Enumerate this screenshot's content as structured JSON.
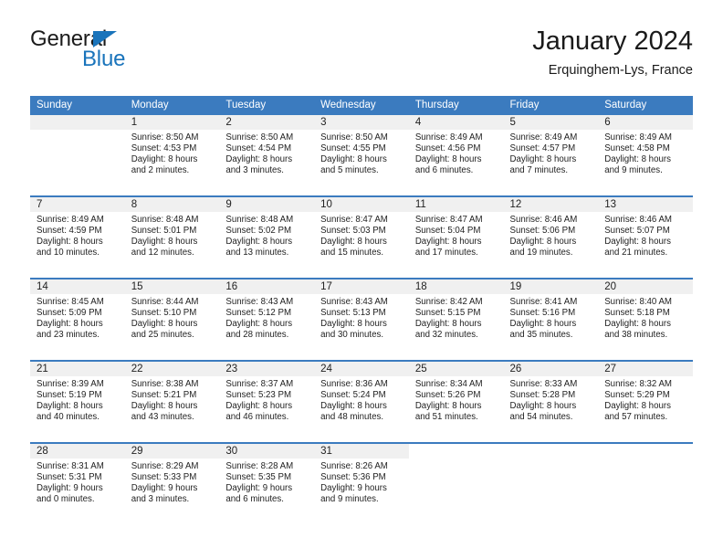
{
  "brand": {
    "name_part1": "General",
    "name_part2": "Blue",
    "colors": {
      "dark": "#1b1b1b",
      "blue": "#1a74bb"
    }
  },
  "header": {
    "title": "January 2024",
    "subtitle": "Erquinghem-Lys, France"
  },
  "theme": {
    "header_blue": "#3b7bbf",
    "daynum_band": "#f0f0f0",
    "cell_bg": "#ffffff",
    "text": "#1f1f1f"
  },
  "weekday_headers": [
    "Sunday",
    "Monday",
    "Tuesday",
    "Wednesday",
    "Thursday",
    "Friday",
    "Saturday"
  ],
  "weeks": [
    [
      {
        "day": "",
        "lines": []
      },
      {
        "day": "1",
        "lines": [
          "Sunrise: 8:50 AM",
          "Sunset: 4:53 PM",
          "Daylight: 8 hours",
          "and 2 minutes."
        ]
      },
      {
        "day": "2",
        "lines": [
          "Sunrise: 8:50 AM",
          "Sunset: 4:54 PM",
          "Daylight: 8 hours",
          "and 3 minutes."
        ]
      },
      {
        "day": "3",
        "lines": [
          "Sunrise: 8:50 AM",
          "Sunset: 4:55 PM",
          "Daylight: 8 hours",
          "and 5 minutes."
        ]
      },
      {
        "day": "4",
        "lines": [
          "Sunrise: 8:49 AM",
          "Sunset: 4:56 PM",
          "Daylight: 8 hours",
          "and 6 minutes."
        ]
      },
      {
        "day": "5",
        "lines": [
          "Sunrise: 8:49 AM",
          "Sunset: 4:57 PM",
          "Daylight: 8 hours",
          "and 7 minutes."
        ]
      },
      {
        "day": "6",
        "lines": [
          "Sunrise: 8:49 AM",
          "Sunset: 4:58 PM",
          "Daylight: 8 hours",
          "and 9 minutes."
        ]
      }
    ],
    [
      {
        "day": "7",
        "lines": [
          "Sunrise: 8:49 AM",
          "Sunset: 4:59 PM",
          "Daylight: 8 hours",
          "and 10 minutes."
        ]
      },
      {
        "day": "8",
        "lines": [
          "Sunrise: 8:48 AM",
          "Sunset: 5:01 PM",
          "Daylight: 8 hours",
          "and 12 minutes."
        ]
      },
      {
        "day": "9",
        "lines": [
          "Sunrise: 8:48 AM",
          "Sunset: 5:02 PM",
          "Daylight: 8 hours",
          "and 13 minutes."
        ]
      },
      {
        "day": "10",
        "lines": [
          "Sunrise: 8:47 AM",
          "Sunset: 5:03 PM",
          "Daylight: 8 hours",
          "and 15 minutes."
        ]
      },
      {
        "day": "11",
        "lines": [
          "Sunrise: 8:47 AM",
          "Sunset: 5:04 PM",
          "Daylight: 8 hours",
          "and 17 minutes."
        ]
      },
      {
        "day": "12",
        "lines": [
          "Sunrise: 8:46 AM",
          "Sunset: 5:06 PM",
          "Daylight: 8 hours",
          "and 19 minutes."
        ]
      },
      {
        "day": "13",
        "lines": [
          "Sunrise: 8:46 AM",
          "Sunset: 5:07 PM",
          "Daylight: 8 hours",
          "and 21 minutes."
        ]
      }
    ],
    [
      {
        "day": "14",
        "lines": [
          "Sunrise: 8:45 AM",
          "Sunset: 5:09 PM",
          "Daylight: 8 hours",
          "and 23 minutes."
        ]
      },
      {
        "day": "15",
        "lines": [
          "Sunrise: 8:44 AM",
          "Sunset: 5:10 PM",
          "Daylight: 8 hours",
          "and 25 minutes."
        ]
      },
      {
        "day": "16",
        "lines": [
          "Sunrise: 8:43 AM",
          "Sunset: 5:12 PM",
          "Daylight: 8 hours",
          "and 28 minutes."
        ]
      },
      {
        "day": "17",
        "lines": [
          "Sunrise: 8:43 AM",
          "Sunset: 5:13 PM",
          "Daylight: 8 hours",
          "and 30 minutes."
        ]
      },
      {
        "day": "18",
        "lines": [
          "Sunrise: 8:42 AM",
          "Sunset: 5:15 PM",
          "Daylight: 8 hours",
          "and 32 minutes."
        ]
      },
      {
        "day": "19",
        "lines": [
          "Sunrise: 8:41 AM",
          "Sunset: 5:16 PM",
          "Daylight: 8 hours",
          "and 35 minutes."
        ]
      },
      {
        "day": "20",
        "lines": [
          "Sunrise: 8:40 AM",
          "Sunset: 5:18 PM",
          "Daylight: 8 hours",
          "and 38 minutes."
        ]
      }
    ],
    [
      {
        "day": "21",
        "lines": [
          "Sunrise: 8:39 AM",
          "Sunset: 5:19 PM",
          "Daylight: 8 hours",
          "and 40 minutes."
        ]
      },
      {
        "day": "22",
        "lines": [
          "Sunrise: 8:38 AM",
          "Sunset: 5:21 PM",
          "Daylight: 8 hours",
          "and 43 minutes."
        ]
      },
      {
        "day": "23",
        "lines": [
          "Sunrise: 8:37 AM",
          "Sunset: 5:23 PM",
          "Daylight: 8 hours",
          "and 46 minutes."
        ]
      },
      {
        "day": "24",
        "lines": [
          "Sunrise: 8:36 AM",
          "Sunset: 5:24 PM",
          "Daylight: 8 hours",
          "and 48 minutes."
        ]
      },
      {
        "day": "25",
        "lines": [
          "Sunrise: 8:34 AM",
          "Sunset: 5:26 PM",
          "Daylight: 8 hours",
          "and 51 minutes."
        ]
      },
      {
        "day": "26",
        "lines": [
          "Sunrise: 8:33 AM",
          "Sunset: 5:28 PM",
          "Daylight: 8 hours",
          "and 54 minutes."
        ]
      },
      {
        "day": "27",
        "lines": [
          "Sunrise: 8:32 AM",
          "Sunset: 5:29 PM",
          "Daylight: 8 hours",
          "and 57 minutes."
        ]
      }
    ],
    [
      {
        "day": "28",
        "lines": [
          "Sunrise: 8:31 AM",
          "Sunset: 5:31 PM",
          "Daylight: 9 hours",
          "and 0 minutes."
        ]
      },
      {
        "day": "29",
        "lines": [
          "Sunrise: 8:29 AM",
          "Sunset: 5:33 PM",
          "Daylight: 9 hours",
          "and 3 minutes."
        ]
      },
      {
        "day": "30",
        "lines": [
          "Sunrise: 8:28 AM",
          "Sunset: 5:35 PM",
          "Daylight: 9 hours",
          "and 6 minutes."
        ]
      },
      {
        "day": "31",
        "lines": [
          "Sunrise: 8:26 AM",
          "Sunset: 5:36 PM",
          "Daylight: 9 hours",
          "and 9 minutes."
        ]
      },
      {
        "day": "",
        "lines": [],
        "blank": true
      },
      {
        "day": "",
        "lines": [],
        "blank": true
      },
      {
        "day": "",
        "lines": [],
        "blank": true
      }
    ]
  ]
}
